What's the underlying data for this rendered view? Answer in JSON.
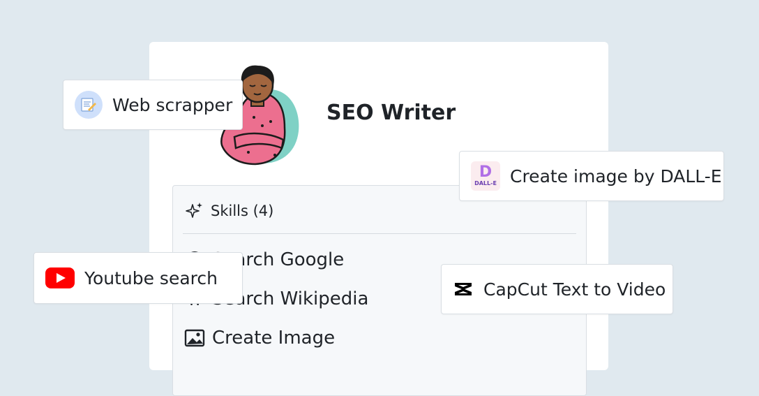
{
  "agent": {
    "name": "SEO Writer"
  },
  "skills": {
    "header": "Skills (4)",
    "items": [
      {
        "label": "Search Google",
        "icon": "google-icon"
      },
      {
        "label": "Search Wikipedia",
        "icon": "wikipedia-icon"
      },
      {
        "label": "Create Image",
        "icon": "image-icon"
      }
    ]
  },
  "chips": {
    "web_scrapper": {
      "label": "Web scrapper",
      "icon": "web-scrapper-icon"
    },
    "dalle": {
      "label": "Create image by DALL-E",
      "icon": "dalle-icon",
      "logo_text": "D",
      "logo_sub": "DALL-E"
    },
    "youtube": {
      "label": "Youtube search",
      "icon": "youtube-icon"
    },
    "capcut": {
      "label": "CapCut Text to Video",
      "icon": "capcut-icon"
    }
  },
  "colors": {
    "background": "#e0e9ef",
    "card": "#ffffff",
    "panel": "#f6f8fa",
    "youtube_red": "#ff0000",
    "avatar_sweater": "#ec6f8f",
    "avatar_blob": "#7fd1c5"
  }
}
